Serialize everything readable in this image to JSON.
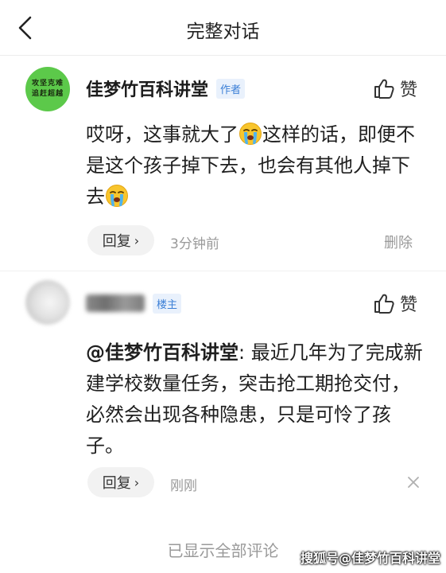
{
  "header": {
    "title": "完整对话",
    "back_icon": "chevron-left-icon"
  },
  "comments": [
    {
      "avatar_text": [
        "攻坚克难",
        "追赶超越"
      ],
      "avatar_color": "#5cc94a",
      "author": "佳梦竹百科讲堂",
      "badge": "作者",
      "like_label": "赞",
      "content_parts": [
        "哎呀，这事就大了",
        "这样的话，即便不是这个孩子掉下去，也会有其他人掉下去"
      ],
      "emoji": "crying-face-icon",
      "reply_label": "回复",
      "time": "3分钟前",
      "action_label": "删除"
    },
    {
      "author_blurred": true,
      "badge": "楼主",
      "like_label": "赞",
      "mention": "@佳梦竹百科讲堂",
      "content": ": 最近几年为了完成新建学校数量任务，突击抢工期抢交付，必然会出现各种隐患，只是可怜了孩子。",
      "reply_label": "回复",
      "time": "刚刚"
    }
  ],
  "footer": {
    "note": "已显示全部评论",
    "watermark": "搜狐号@佳梦竹百科讲堂"
  },
  "colors": {
    "badge_text": "#3b7fd6",
    "badge_bg": "#e9f1fc",
    "secondary_text": "#999999"
  }
}
